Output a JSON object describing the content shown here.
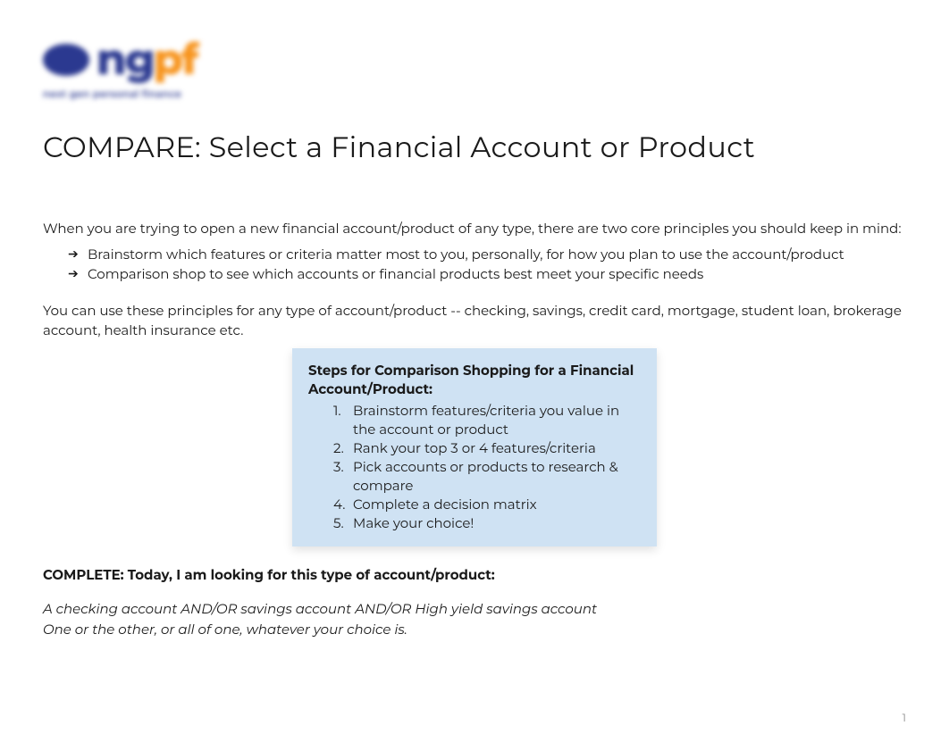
{
  "logo": {
    "brand_letters": [
      "n",
      "g",
      "p",
      "f"
    ],
    "tagline": "next gen personal finance"
  },
  "title": "COMPARE: Select a Financial Account or Product",
  "intro": "When you are trying to open a new financial account/product of any type, there are two core principles you should keep in mind:",
  "principles": [
    "Brainstorm which features or criteria matter most to you, personally, for how you plan to use the account/product",
    "Comparison shop to see which accounts or financial products best meet your specific needs"
  ],
  "usage_paragraph": "You can use these principles for any type of account/product -- checking, savings, credit card, mortgage, student loan, brokerage account, health insurance etc.",
  "steps_box": {
    "heading": "Steps for Comparison Shopping for a Financial Account/Product:",
    "items": [
      "Brainstorm features/criteria you value in the account or product",
      "Rank your top 3 or 4 features/criteria",
      "Pick accounts or products to research & compare",
      "Complete a decision matrix",
      "Make your choice!"
    ]
  },
  "complete_label": "COMPLETE: Today, I am looking for this type of account/product:",
  "response_line1": "A checking account AND/OR savings account AND/OR High yield savings account",
  "response_line2": "One or the other, or all of one, whatever your choice is.",
  "page_number": "1"
}
